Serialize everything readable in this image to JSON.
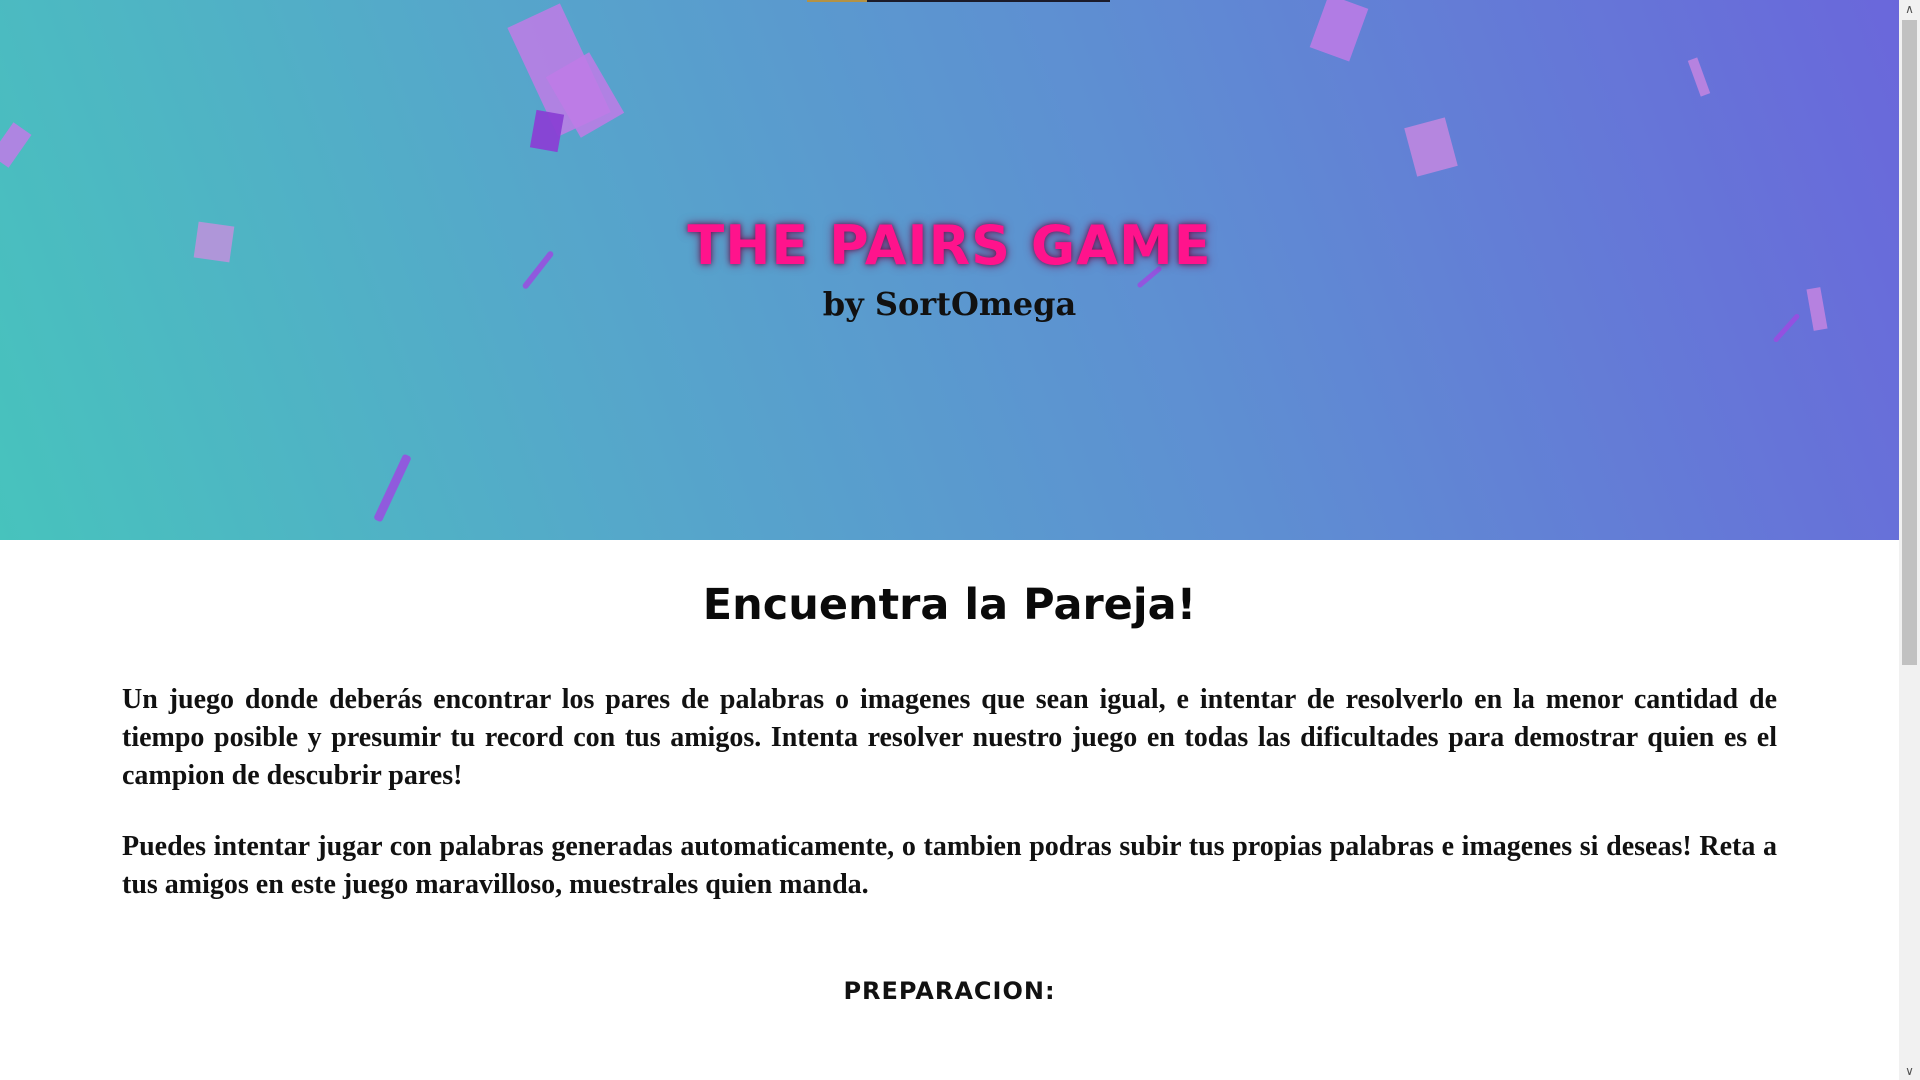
{
  "hero": {
    "title": "THE PAIRS GAME",
    "subtitle": "by SortOmega",
    "title_color": "#ff138c",
    "gradient_colors": [
      "#47c3bd",
      "#55a8ca",
      "#5e8fd2",
      "#6a67db"
    ],
    "confetti_color": "#c07be6"
  },
  "main": {
    "heading": "Encuentra la Pareja!",
    "paragraphs": [
      "Un juego donde deberás encontrar los pares de palabras o imagenes que sean igual, e intentar de resolverlo en la menor cantidad de tiempo posible y presumir tu record con tus amigos. Intenta resolver nuestro juego en todas las dificultades para demostrar quien es el campion de descubrir pares!",
      "Puedes intentar jugar con palabras generadas automaticamente, o tambien podras subir tus propias palabras e imagenes si deseas! Reta a tus amigos en este juego maravilloso, muestrales quien manda."
    ],
    "section_heading": "PREPARACION:"
  },
  "scrollbar": {
    "up_icon": "chevron-up-icon",
    "down_icon": "chevron-down-icon",
    "up_glyph": "∧",
    "down_glyph": "∨"
  }
}
